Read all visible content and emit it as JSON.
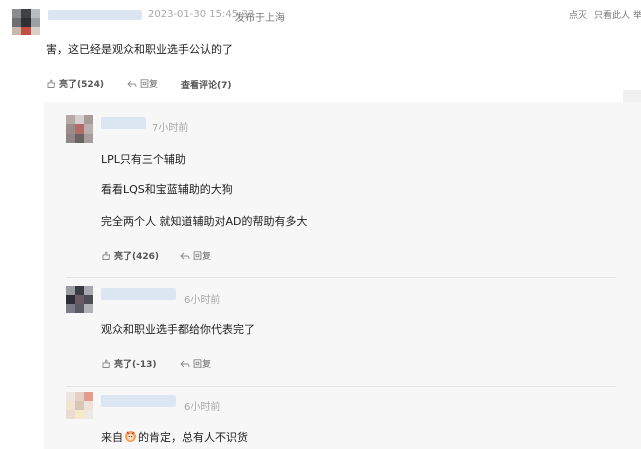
{
  "post": {
    "timestamp": "2023-01-30 15:45:33",
    "location": "发布于上海",
    "actions_right": [
      "点灭",
      "只看此人",
      "举"
    ],
    "text": "害，这已经是观众和职业选手公认的了",
    "like_label": "亮了(524)",
    "reply_label": "回复",
    "view_replies_label": "查看评论(7)"
  },
  "replies": [
    {
      "time": "7小时前",
      "lines": [
        "LPL只有三个辅助",
        "看看LQS和宝蓝辅助的大狗",
        "完全两个人 就知道辅助对AD的帮助有多大"
      ],
      "like_label": "亮了(426)",
      "reply_label": "回复"
    },
    {
      "time": "6小时前",
      "lines": [
        "观众和职业选手都给你代表完了"
      ],
      "like_label": "亮了(-13)",
      "reply_label": "回复"
    },
    {
      "time": "6小时前",
      "lines": [
        "来自",
        "的肯定，总有人不识货"
      ]
    }
  ],
  "colors": {
    "background": "#ffffff",
    "panel": "#f7f7f7",
    "meta_text": "#a8a8a8",
    "blur": "#dce6f2"
  },
  "icons": [
    "thumbs-up-icon",
    "reply-arrow-icon",
    "emoji-icon"
  ]
}
